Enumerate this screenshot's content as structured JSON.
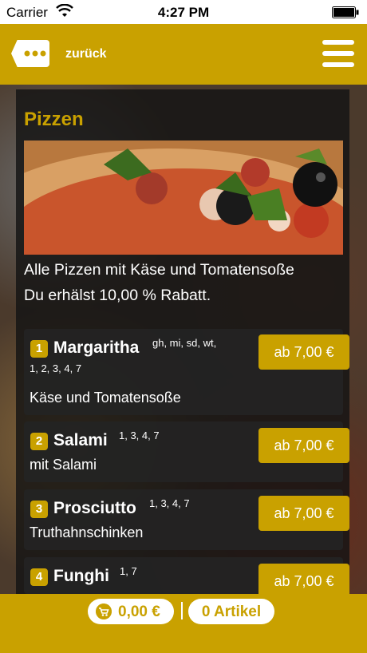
{
  "status_bar": {
    "carrier": "Carrier",
    "time": "4:27 PM"
  },
  "nav": {
    "back_label": "zurück"
  },
  "section": {
    "title": "Pizzen",
    "description_line1": "Alle Pizzen mit Käse und Tomatensoße",
    "description_line2": "Du erhälst 10,00 % Rabatt."
  },
  "items": [
    {
      "number": "1",
      "name": "Margaritha",
      "sup": "gh, mi, sd, wt,",
      "sup2": "1, 2, 3, 4, 7",
      "description": "Käse und Tomatensoße",
      "price": "ab 7,00 €"
    },
    {
      "number": "2",
      "name": "Salami",
      "sup": "1, 3, 4, 7",
      "description": "mit Salami",
      "price": "ab 7,00 €"
    },
    {
      "number": "3",
      "name": "Prosciutto",
      "sup": "1, 3, 4, 7",
      "description": "Truthahnschinken",
      "price": "ab 7,00 €"
    },
    {
      "number": "4",
      "name": "Funghi",
      "sup": "1, 7",
      "price": "ab 7,00 €"
    }
  ],
  "cart": {
    "total": "0,00 €",
    "articles": "0 Artikel"
  },
  "colors": {
    "accent": "#c9a100",
    "panel": "#141414"
  },
  "icons": [
    "wifi-icon",
    "battery-icon",
    "back-dots-icon",
    "hamburger-menu-icon",
    "cart-icon"
  ]
}
